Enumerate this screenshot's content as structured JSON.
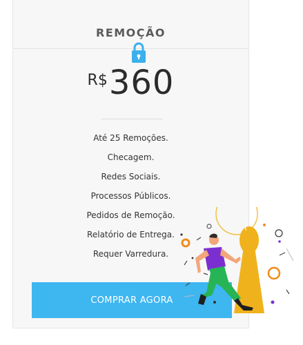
{
  "plan": {
    "title": "REMOÇÃO",
    "currency": "R$",
    "amount": "360",
    "features": [
      "Até 25 Remoções.",
      "Checagem.",
      "Redes Sociais.",
      "Processos Públicos.",
      "Pedidos de Remoção.",
      "Relatório de Entrega.",
      "Requer Varredura."
    ],
    "button_label": "COMPRAR AGORA"
  },
  "colors": {
    "accent": "#3eb6f0",
    "lock": "#3ab0ec",
    "keyhole": "#f0b21c",
    "person_shirt": "#7b2fd0",
    "person_pants": "#27b455"
  },
  "icons": {
    "lock": "lock-icon",
    "illustration": "person-running-keyhole-illustration"
  }
}
